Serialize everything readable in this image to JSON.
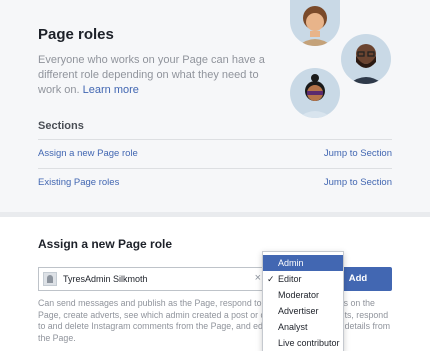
{
  "header": {
    "title": "Page roles",
    "description": "Everyone who works on your Page can have a different role depending on what they need to work on.",
    "learn_more": "Learn more"
  },
  "sections": {
    "label": "Sections",
    "items": [
      {
        "name": "Assign a new Page role",
        "jump": "Jump to Section"
      },
      {
        "name": "Existing Page roles",
        "jump": "Jump to Section"
      }
    ]
  },
  "assign": {
    "title": "Assign a new Page role",
    "input_value": "TyresAdmin Silkmoth",
    "clear_glyph": "×",
    "add_label": "Add",
    "help_text": "Can send messages and publish as the Page, respond to and delete comments on the Page, create adverts, see which admin created a post or comment, view insights, respond to and delete Instagram comments from the Page, and edit Instagram account details from the Page."
  },
  "role_dropdown": {
    "options": [
      "Admin",
      "Editor",
      "Moderator",
      "Advertiser",
      "Analyst",
      "Live contributor"
    ],
    "highlighted": "Admin",
    "checked": "Editor",
    "check_glyph": "✓"
  },
  "colors": {
    "accent": "#4267b2",
    "muted_text": "#90949c",
    "avatar_bg": "#c9d9e6"
  }
}
